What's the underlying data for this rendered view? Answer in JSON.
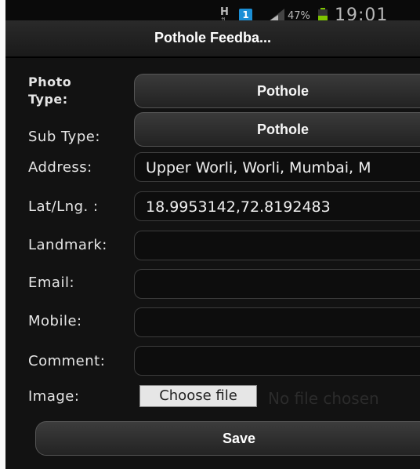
{
  "status_bar": {
    "network": "H",
    "notification_count": "1",
    "battery_percent": "47%",
    "time": "19:01"
  },
  "title_bar": {
    "title": "Pothole Feedba..."
  },
  "form": {
    "photo_type_label": "Photo Type:",
    "photo_type_value": "Pothole",
    "sub_type_label": "Sub Type:",
    "sub_type_value": "Pothole",
    "address_label": "Address:",
    "address_value": "Upper Worli, Worli, Mumbai, M",
    "latlng_label": "Lat/Lng. :",
    "latlng_value": "18.9953142,72.8192483",
    "landmark_label": "Landmark:",
    "landmark_value": "",
    "email_label": "Email:",
    "email_value": "",
    "mobile_label": "Mobile:",
    "mobile_value": "",
    "comment_label": "Comment:",
    "comment_value": "",
    "image_label": "Image:",
    "choose_file_label": "Choose file",
    "no_file_text": "No file chosen",
    "save_label": "Save"
  },
  "icons": {
    "signal": "signal-strength-icon",
    "battery": "battery-icon",
    "network": "network-type-icon",
    "notification": "notification-icon"
  },
  "colors": {
    "accent_blue": "#1b8fd6",
    "battery_green": "#7ec400",
    "background": "#121212"
  }
}
